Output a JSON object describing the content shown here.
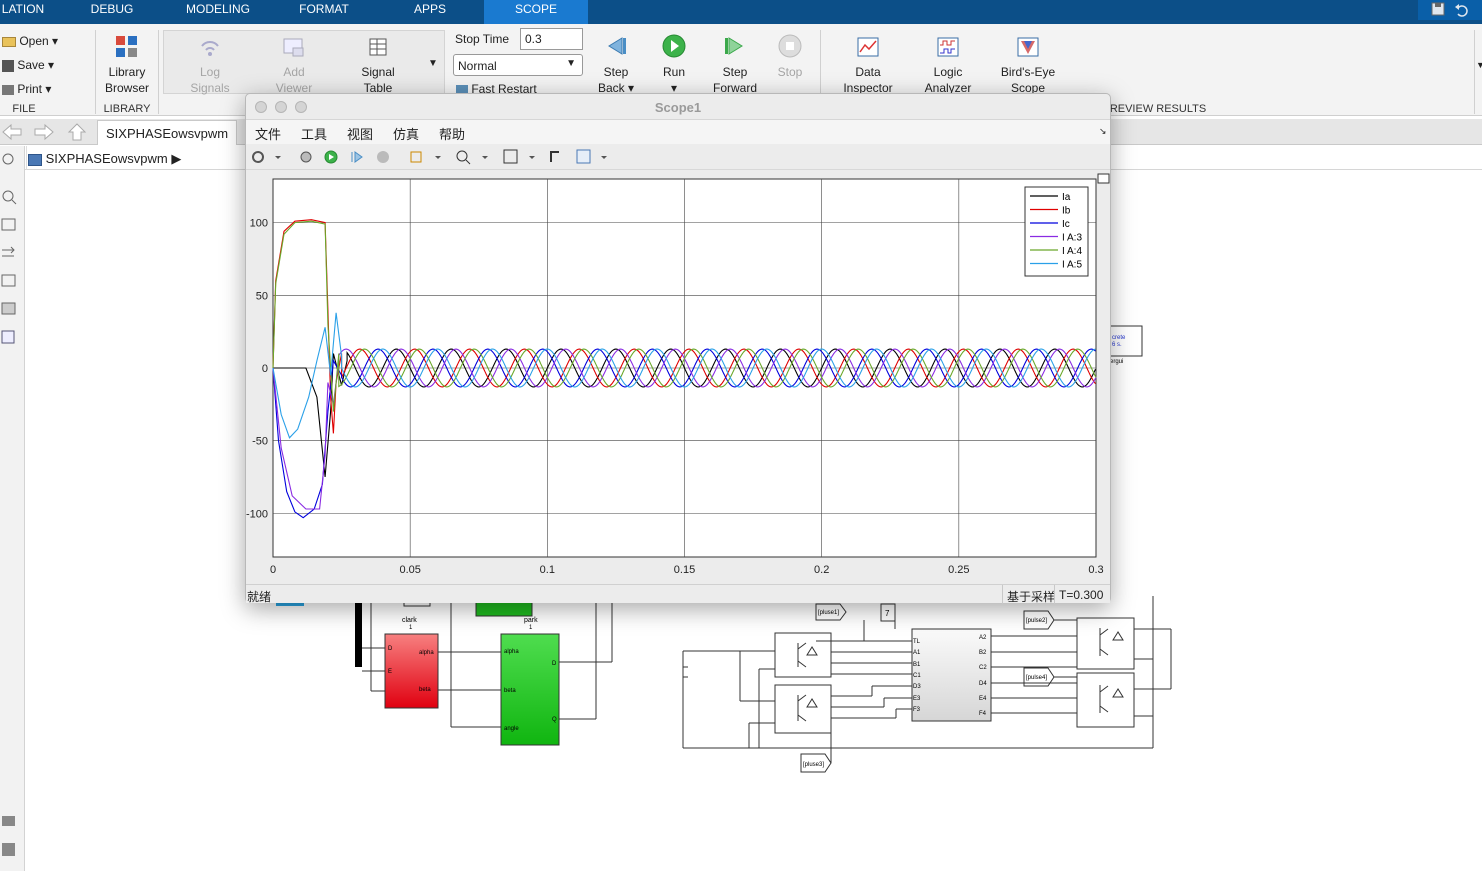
{
  "tabs": {
    "simulation": "LATION",
    "debug": "DEBUG",
    "modeling": "MODELING",
    "format": "FORMAT",
    "apps": "APPS",
    "scope": "SCOPE"
  },
  "file_section": {
    "open": "Open",
    "save": "Save",
    "print": "Print",
    "label": "FILE"
  },
  "library_section": {
    "browser_l1": "Library",
    "browser_l2": "Browser",
    "label": "LIBRARY"
  },
  "prepare": {
    "log_l1": "Log",
    "log_l2": "Signals",
    "add_l1": "Add",
    "add_l2": "Viewer",
    "sig_l1": "Signal",
    "sig_l2": "Table"
  },
  "simulate": {
    "stop_time_label": "Stop Time",
    "stop_time_value": "0.3",
    "mode": "Normal",
    "fast_restart": "Fast Restart",
    "step_back_l1": "Step",
    "step_back_l2": "Back",
    "run": "Run",
    "step_fwd_l1": "Step",
    "step_fwd_l2": "Forward",
    "stop": "Stop"
  },
  "review": {
    "di_l1": "Data",
    "di_l2": "Inspector",
    "la_l1": "Logic",
    "la_l2": "Analyzer",
    "be_l1": "Bird's-Eye",
    "be_l2": "Scope",
    "label": "REVIEW RESULTS"
  },
  "nav": {
    "model_tab": "SIXPHASEowsvpwm",
    "breadcrumb": "SIXPHASEowsvpwm"
  },
  "scope": {
    "title": "Scope1",
    "menu": [
      "文件",
      "工具",
      "视图",
      "仿真",
      "帮助"
    ],
    "status_left": "就绪",
    "status_mid": "基于采样",
    "status_right": "T=0.300"
  },
  "diagram": {
    "clark": "clark",
    "park": "park",
    "one": "1",
    "alpha": "alpha",
    "beta": "beta",
    "angle": "angle",
    "D": "D",
    "Q": "Q",
    "E": "E",
    "pulse1": "[pluse1]",
    "pulse2": "[pulse2]",
    "pulse3": "[pluse3]",
    "pulse4": "[pulse4]",
    "seven": "7",
    "tl": "TL",
    "in_ports": [
      "A1",
      "B1",
      "C1",
      "D3",
      "E3",
      "F3"
    ],
    "out_ports": [
      "A2",
      "B2",
      "C2",
      "D4",
      "E4",
      "F4"
    ],
    "discrete": "crete\n6 s.",
    "powergui": "ergui"
  },
  "chart_data": {
    "type": "line",
    "title": "",
    "xlim": [
      0,
      0.3
    ],
    "ylim": [
      -130,
      130
    ],
    "xticks": [
      "0",
      "0.05",
      "0.1",
      "0.15",
      "0.2",
      "0.25",
      "0.3"
    ],
    "yticks": [
      "100",
      "50",
      "0",
      "-50",
      "-100"
    ],
    "grid": true,
    "legend_position": "top-right",
    "steady_amplitude": 13,
    "frequency_hz": 50,
    "series": [
      {
        "name": "Ia",
        "color": "#000000",
        "phase_deg": 0,
        "transient": [
          [
            0,
            0
          ],
          [
            0.012,
            0
          ],
          [
            0.016,
            -20
          ],
          [
            0.019,
            -75
          ],
          [
            0.021,
            -30
          ],
          [
            0.022,
            10
          ],
          [
            0.025,
            -12
          ],
          [
            0.027,
            5
          ]
        ]
      },
      {
        "name": "Ib",
        "color": "#e00000",
        "phase_deg": -120,
        "transient": [
          [
            0,
            0
          ],
          [
            0.001,
            60
          ],
          [
            0.004,
            94
          ],
          [
            0.008,
            101
          ],
          [
            0.014,
            102
          ],
          [
            0.019,
            100
          ],
          [
            0.02,
            40
          ],
          [
            0.021,
            -20
          ],
          [
            0.022,
            -45
          ],
          [
            0.023,
            -10
          ],
          [
            0.025,
            10
          ]
        ]
      },
      {
        "name": "Ic",
        "color": "#0000dd",
        "phase_deg": 120,
        "transient": [
          [
            0,
            0
          ],
          [
            0.002,
            -50
          ],
          [
            0.005,
            -85
          ],
          [
            0.008,
            -99
          ],
          [
            0.011,
            -103
          ],
          [
            0.015,
            -97
          ],
          [
            0.018,
            -80
          ],
          [
            0.02,
            -30
          ],
          [
            0.022,
            5
          ],
          [
            0.025,
            -5
          ]
        ]
      },
      {
        "name": "I A:3",
        "color": "#8a2be2",
        "phase_deg": -30,
        "transient": [
          [
            0,
            0
          ],
          [
            0.003,
            -55
          ],
          [
            0.007,
            -88
          ],
          [
            0.012,
            -97
          ],
          [
            0.017,
            -97
          ],
          [
            0.019,
            -60
          ],
          [
            0.02,
            -10
          ],
          [
            0.022,
            -25
          ],
          [
            0.024,
            5
          ]
        ]
      },
      {
        "name": "I A:4",
        "color": "#6aa82a",
        "phase_deg": -150,
        "transient": [
          [
            0,
            0
          ],
          [
            0.001,
            58
          ],
          [
            0.004,
            92
          ],
          [
            0.008,
            100
          ],
          [
            0.014,
            101
          ],
          [
            0.019,
            99
          ],
          [
            0.02,
            30
          ],
          [
            0.022,
            -30
          ],
          [
            0.024,
            10
          ]
        ]
      },
      {
        "name": "I A:5",
        "color": "#2aa0e8",
        "phase_deg": 90,
        "transient": [
          [
            0,
            0
          ],
          [
            0.003,
            -32
          ],
          [
            0.006,
            -48
          ],
          [
            0.009,
            -42
          ],
          [
            0.013,
            -20
          ],
          [
            0.016,
            5
          ],
          [
            0.019,
            28
          ],
          [
            0.021,
            -5
          ],
          [
            0.023,
            38
          ],
          [
            0.025,
            8
          ]
        ]
      }
    ]
  }
}
